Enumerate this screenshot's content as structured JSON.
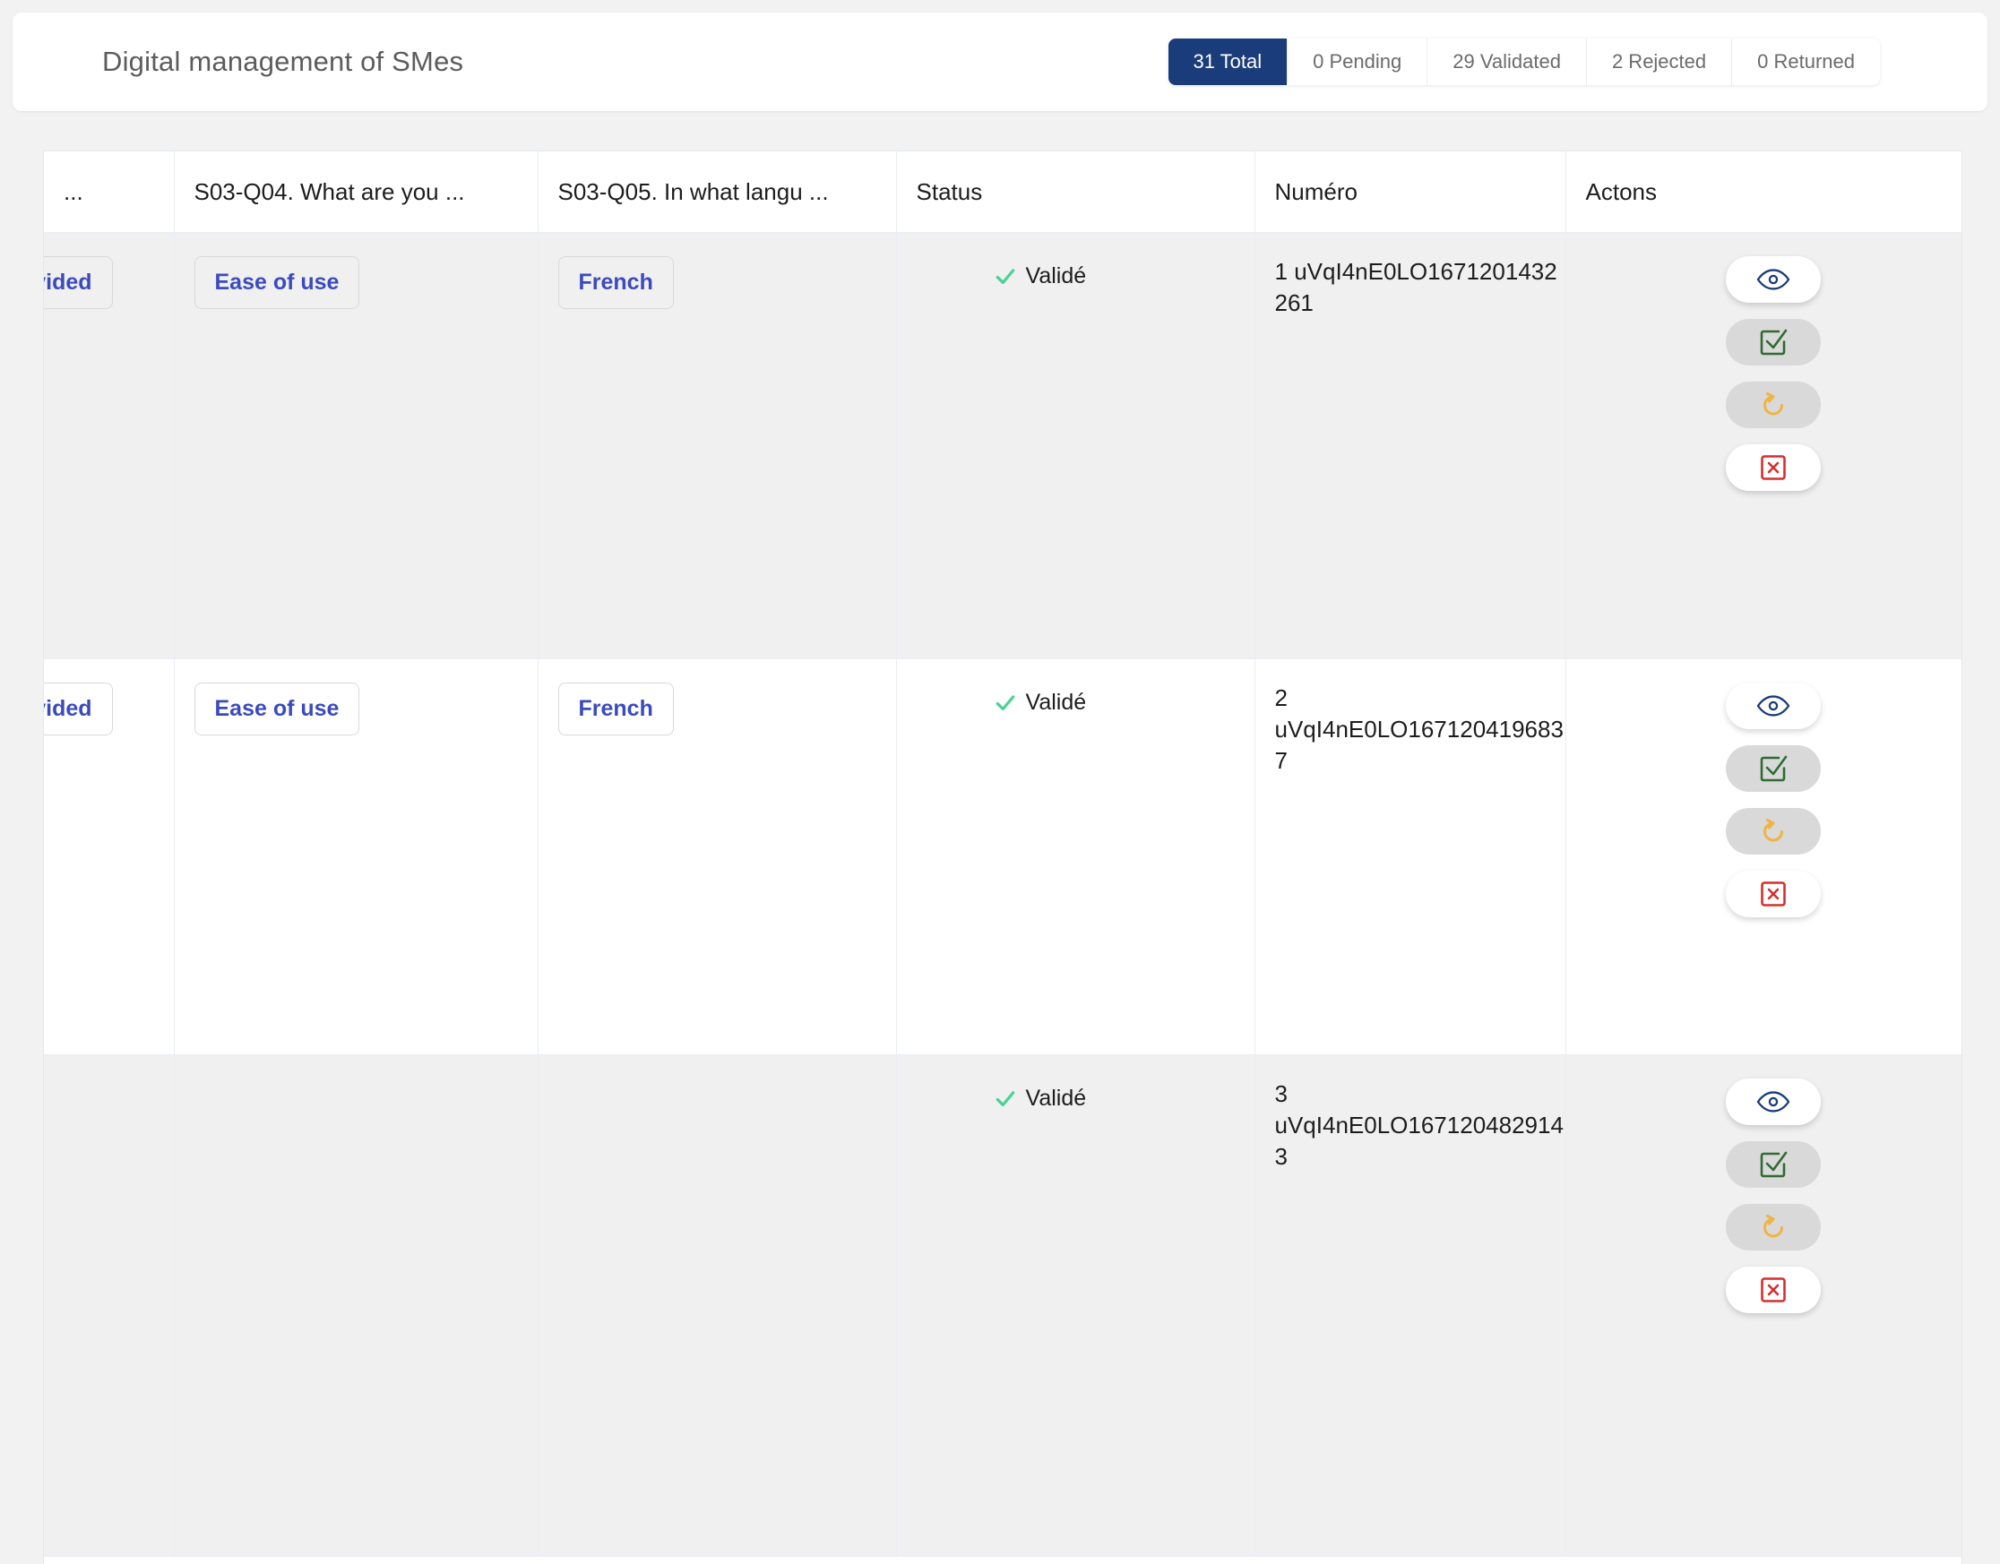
{
  "header": {
    "title": "Digital management of SMes",
    "tabs": [
      {
        "label": "31 Total",
        "active": true
      },
      {
        "label": "0 Pending",
        "active": false
      },
      {
        "label": "29 Validated",
        "active": false
      },
      {
        "label": "2 Rejected",
        "active": false
      },
      {
        "label": "0 Returned",
        "active": false
      }
    ]
  },
  "colors": {
    "active_tab_bg": "#1a3c7b",
    "chip_text": "#3b4bbd",
    "validated_check": "#4ad295",
    "view_icon": "#1a3c7b",
    "approve_icon": "#2f6b33",
    "return_icon": "#f0b440",
    "reject_icon": "#d32f2f",
    "row_shaded_bg": "#f0f0f0"
  },
  "table": {
    "columns": [
      {
        "label": "...",
        "name": "truncated"
      },
      {
        "label": "S03-Q04. What are you ...",
        "name": "s03-q04"
      },
      {
        "label": "S03-Q05. In what langu ...",
        "name": "s03-q05"
      },
      {
        "label": "Status",
        "name": "status"
      },
      {
        "label": "Numéro",
        "name": "numero"
      },
      {
        "label": "Actons",
        "name": "actions"
      }
    ],
    "rows": [
      {
        "shaded": true,
        "col0_chip": "ovided",
        "q04_chip": "Ease of use",
        "q05_chip": "French",
        "status": "Validé",
        "numero_seq": "1",
        "numero_id": "uVqI4nE0LO1671201432261",
        "numero_inline": true
      },
      {
        "shaded": false,
        "col0_chip": "ovided",
        "q04_chip": "Ease of use",
        "q05_chip": "French",
        "status": "Validé",
        "numero_seq": "2",
        "numero_id": "uVqI4nE0LO1671204196837",
        "numero_inline": false
      },
      {
        "shaded": true,
        "col0_chip": "",
        "q04_chip": "",
        "q05_chip": "",
        "status": "Validé",
        "numero_seq": "3",
        "numero_id": "uVqI4nE0LO1671204829143",
        "numero_inline": false
      }
    ],
    "action_buttons": [
      {
        "name": "view-button",
        "icon": "eye-icon",
        "style": "light"
      },
      {
        "name": "approve-button",
        "icon": "check-square-icon",
        "style": "muted"
      },
      {
        "name": "return-button",
        "icon": "undo-arrow-icon",
        "style": "muted"
      },
      {
        "name": "reject-button",
        "icon": "x-square-icon",
        "style": "light"
      }
    ]
  }
}
